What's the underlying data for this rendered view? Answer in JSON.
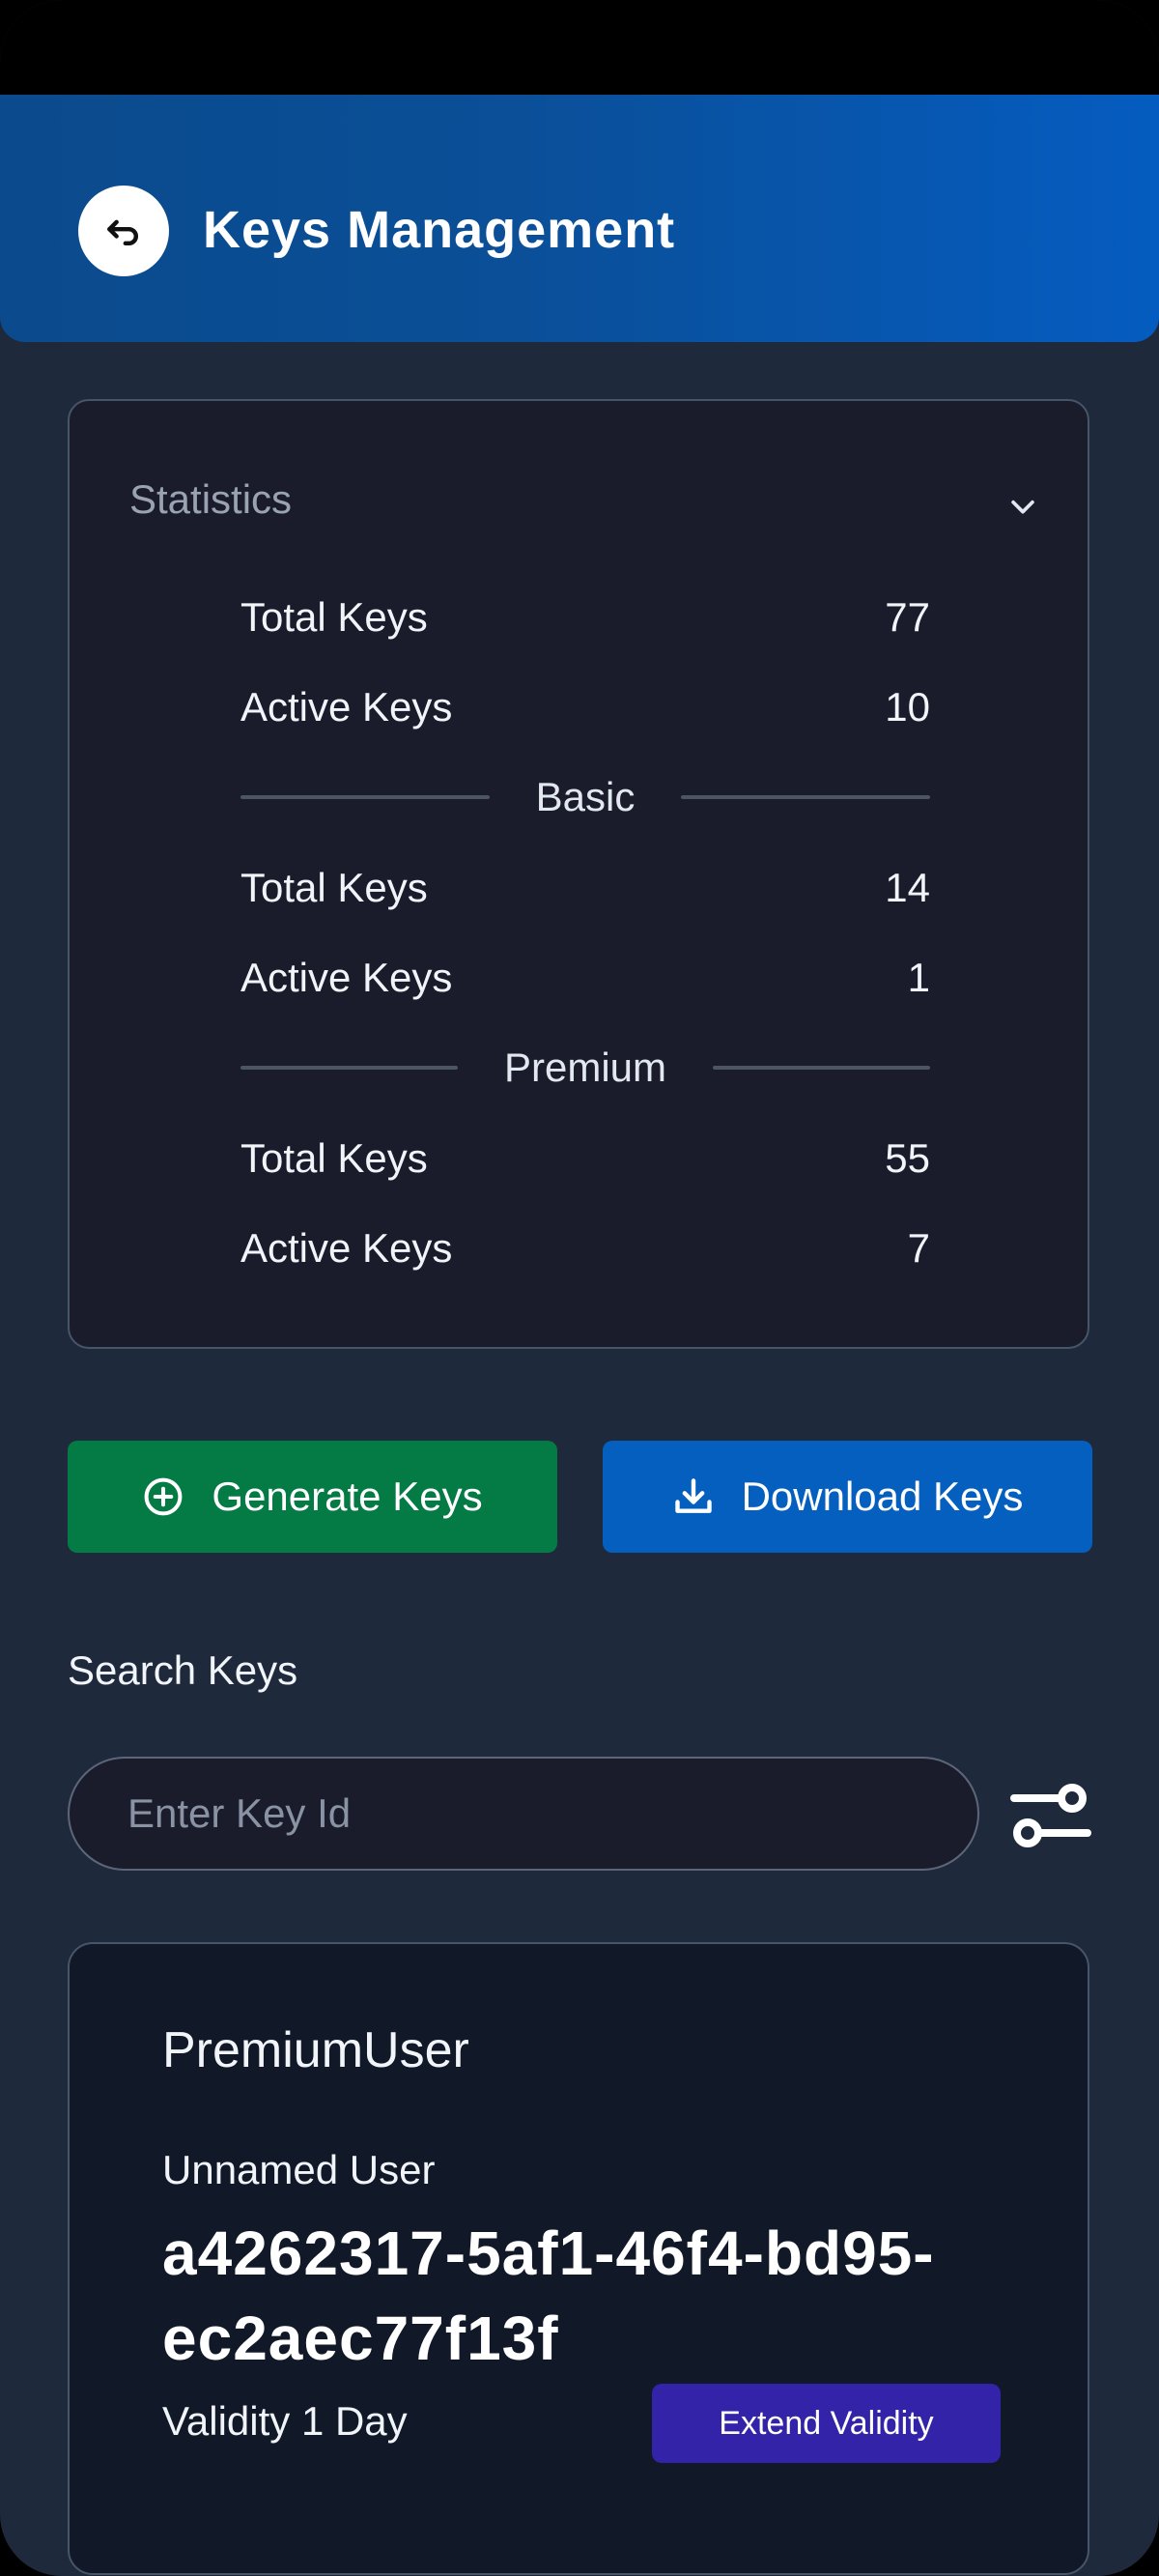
{
  "header": {
    "title": "Keys Management",
    "back_icon": "back-arrow-icon"
  },
  "statistics": {
    "title": "Statistics",
    "toggle_icon": "chevron-down-icon",
    "overall": [
      {
        "label": "Total Keys",
        "value": "77"
      },
      {
        "label": "Active Keys",
        "value": "10"
      }
    ],
    "basic": {
      "label": "Basic",
      "rows": [
        {
          "label": "Total Keys",
          "value": "14"
        },
        {
          "label": "Active Keys",
          "value": "1"
        }
      ]
    },
    "premium": {
      "label": "Premium",
      "rows": [
        {
          "label": "Total Keys",
          "value": "55"
        },
        {
          "label": "Active Keys",
          "value": "7"
        }
      ]
    }
  },
  "actions": {
    "generate_label": "Generate Keys",
    "generate_icon": "plus-circle-icon",
    "download_label": "Download Keys",
    "download_icon": "download-icon"
  },
  "search": {
    "label": "Search Keys",
    "placeholder": "Enter Key Id",
    "value": "",
    "filter_icon": "filter-icon"
  },
  "key_card": {
    "type": "PremiumUser",
    "user": "Unnamed User",
    "key_id": "a4262317-5af1-46f4-bd95-ec2aec77f13f",
    "validity": "Validity 1 Day",
    "extend_label": "Extend Validity"
  },
  "colors": {
    "background": "#1e293b",
    "card": "#1a1c2c",
    "header_start": "#0b4a8c",
    "header_end": "#055cc0",
    "generate": "#047a45",
    "download": "#055fbe",
    "extend": "#3323a8"
  }
}
